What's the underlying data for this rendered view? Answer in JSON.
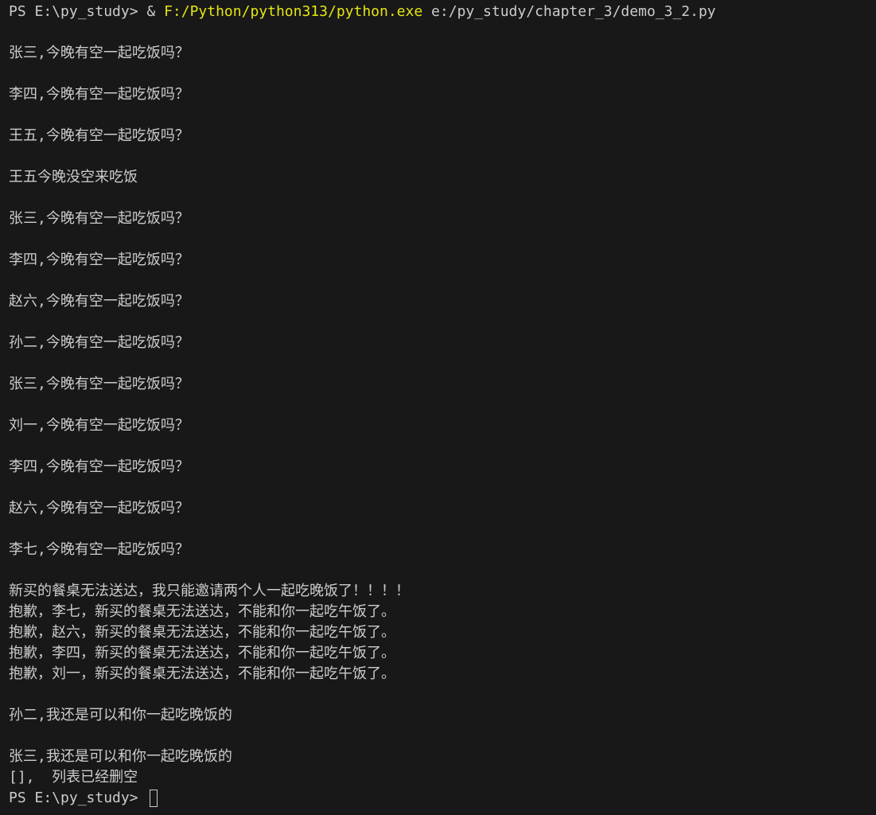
{
  "terminal": {
    "command": {
      "prompt": "PS E:\\py_study> ",
      "call_op": "& ",
      "executable": "F:/Python/python313/python.exe",
      "script": " e:/py_study/chapter_3/demo_3_2.py"
    },
    "output": [
      "",
      "张三,今晚有空一起吃饭吗？",
      "",
      "李四,今晚有空一起吃饭吗？",
      "",
      "王五,今晚有空一起吃饭吗？",
      "",
      "王五今晚没空来吃饭",
      "",
      "张三,今晚有空一起吃饭吗？",
      "",
      "李四,今晚有空一起吃饭吗？",
      "",
      "赵六,今晚有空一起吃饭吗？",
      "",
      "孙二,今晚有空一起吃饭吗？",
      "",
      "张三,今晚有空一起吃饭吗？",
      "",
      "刘一,今晚有空一起吃饭吗？",
      "",
      "李四,今晚有空一起吃饭吗？",
      "",
      "赵六,今晚有空一起吃饭吗？",
      "",
      "李七,今晚有空一起吃饭吗？",
      "",
      "新买的餐桌无法送达，我只能邀请两个人一起吃晚饭了！！！！",
      "抱歉，李七，新买的餐桌无法送达，不能和你一起吃午饭了。",
      "抱歉，赵六，新买的餐桌无法送达，不能和你一起吃午饭了。",
      "抱歉，李四，新买的餐桌无法送达，不能和你一起吃午饭了。",
      "抱歉，刘一，新买的餐桌无法送达，不能和你一起吃午饭了。",
      "",
      "孙二,我还是可以和你一起吃晚饭的",
      "",
      "张三,我还是可以和你一起吃晚饭的",
      "[],  列表已经删空"
    ],
    "final_prompt": "PS E:\\py_study> "
  }
}
